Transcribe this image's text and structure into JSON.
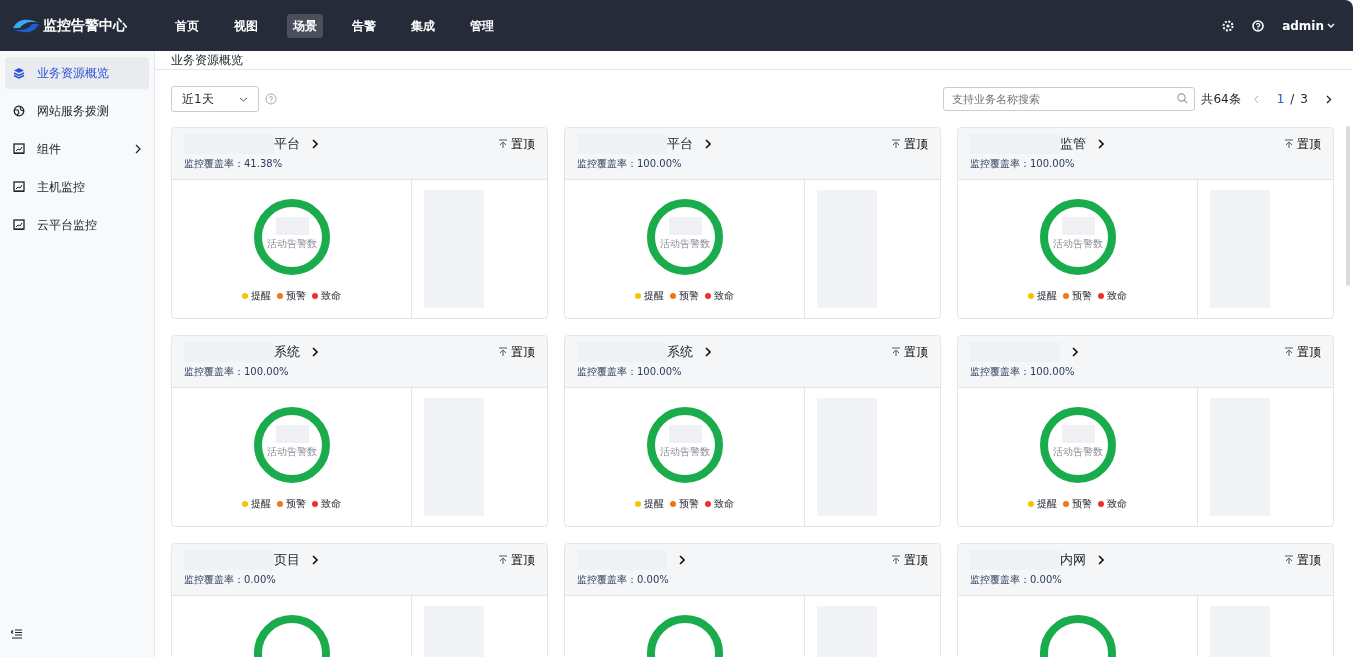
{
  "app": {
    "title": "监控告警中心"
  },
  "menu": [
    {
      "label": "首页",
      "selected": false
    },
    {
      "label": "视图",
      "selected": false
    },
    {
      "label": "场景",
      "selected": true
    },
    {
      "label": "告警",
      "selected": false
    },
    {
      "label": "集成",
      "selected": false
    },
    {
      "label": "管理",
      "selected": false
    }
  ],
  "user": {
    "name": "admin"
  },
  "sidebar": {
    "items": [
      {
        "kind": "layers",
        "label": "业务资源概览",
        "selected": true,
        "expandable": false
      },
      {
        "kind": "globe",
        "label": "网站服务拨测",
        "selected": false,
        "expandable": false
      },
      {
        "kind": "monitor",
        "label": "组件",
        "selected": false,
        "expandable": true
      },
      {
        "kind": "monitor",
        "label": "主机监控",
        "selected": false,
        "expandable": false
      },
      {
        "kind": "monitor",
        "label": "云平台监控",
        "selected": false,
        "expandable": false
      }
    ]
  },
  "breadcrumb": "业务资源概览",
  "toolbar": {
    "range": "近1天",
    "search": {
      "placeholder": "支持业务名称搜索"
    },
    "total": "共64条",
    "page": "1",
    "separator": "/",
    "pages": "3"
  },
  "cards": [
    {
      "title": "平台",
      "coverage": "监控覆盖率：41.38%",
      "pin": "置顶",
      "center_label": "活动告警数",
      "legend": [
        {
          "label": "提醒",
          "color": "#f5c400"
        },
        {
          "label": "预警",
          "color": "#f07814"
        },
        {
          "label": "致命",
          "color": "#f0302f"
        }
      ]
    },
    {
      "title": "平台",
      "coverage": "监控覆盖率：100.00%",
      "pin": "置顶",
      "center_label": "活动告警数",
      "legend": [
        {
          "label": "提醒",
          "color": "#f5c400"
        },
        {
          "label": "预警",
          "color": "#f07814"
        },
        {
          "label": "致命",
          "color": "#f0302f"
        }
      ]
    },
    {
      "title": "监管",
      "coverage": "监控覆盖率：100.00%",
      "pin": "置顶",
      "center_label": "活动告警数",
      "legend": [
        {
          "label": "提醒",
          "color": "#f5c400"
        },
        {
          "label": "预警",
          "color": "#f07814"
        },
        {
          "label": "致命",
          "color": "#f0302f"
        }
      ]
    },
    {
      "title": "系统",
      "coverage": "监控覆盖率：100.00%",
      "pin": "置顶",
      "center_label": "活动告警数",
      "legend": [
        {
          "label": "提醒",
          "color": "#f5c400"
        },
        {
          "label": "预警",
          "color": "#f07814"
        },
        {
          "label": "致命",
          "color": "#f0302f"
        }
      ]
    },
    {
      "title": "系统",
      "coverage": "监控覆盖率：100.00%",
      "pin": "置顶",
      "center_label": "活动告警数",
      "legend": [
        {
          "label": "提醒",
          "color": "#f5c400"
        },
        {
          "label": "预警",
          "color": "#f07814"
        },
        {
          "label": "致命",
          "color": "#f0302f"
        }
      ]
    },
    {
      "coverage": "监控覆盖率：100.00%",
      "pin": "置顶",
      "center_label": "活动告警数",
      "legend": [
        {
          "label": "提醒",
          "color": "#f5c400"
        },
        {
          "label": "预警",
          "color": "#f07814"
        },
        {
          "label": "致命",
          "color": "#f0302f"
        }
      ]
    },
    {
      "title": "页目",
      "coverage": "监控覆盖率：0.00%",
      "pin": "置顶"
    },
    {
      "coverage": "监控覆盖率：0.00%",
      "pin": "置顶"
    },
    {
      "title": "内网",
      "coverage": "监控覆盖率：0.00%",
      "pin": "置顶"
    }
  ]
}
